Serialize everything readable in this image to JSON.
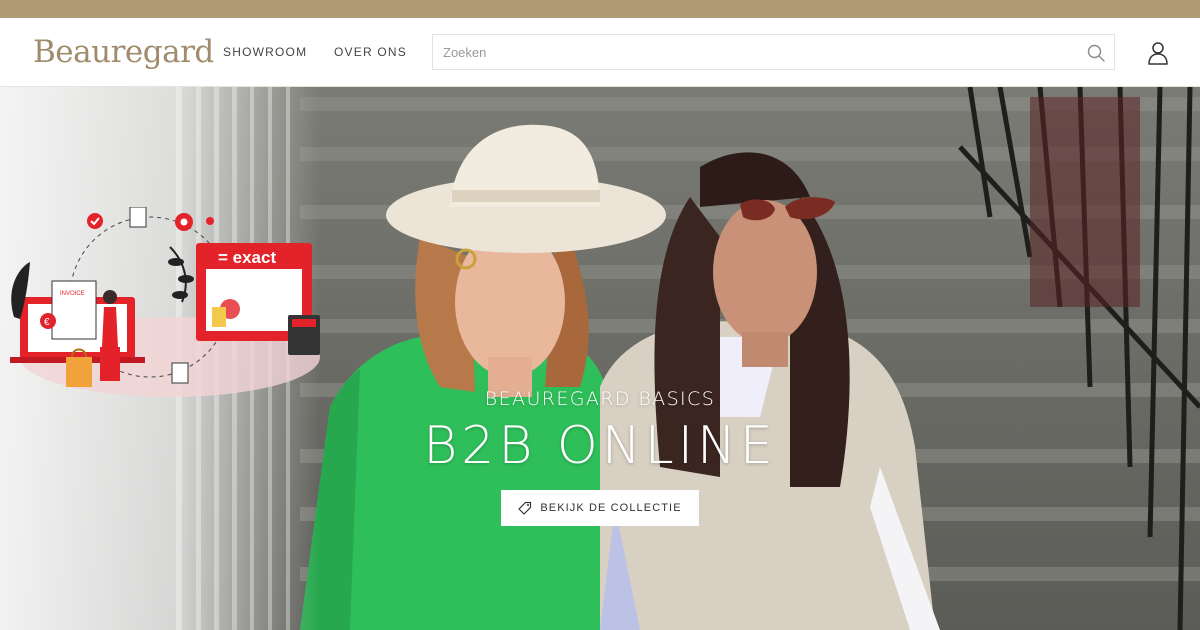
{
  "header": {
    "logo": "Beauregard",
    "nav": [
      {
        "label": "SHOWROOM"
      },
      {
        "label": "OVER ONS"
      }
    ],
    "search": {
      "placeholder": "Zoeken",
      "value": ""
    }
  },
  "hero": {
    "subtitle": "BEAUREGARD BASICS",
    "title": "B2B ONLINE",
    "cta_label": "BEKIJK DE COLLECTIE"
  },
  "illustration": {
    "brand_badge": "= exact",
    "document_label": "INVOICE",
    "currency_symbol": "€"
  },
  "colors": {
    "top_strip": "#b09a74",
    "logo": "#a08c6c",
    "accent_red": "#e4222a",
    "sweater_green": "#2fbf5a"
  }
}
